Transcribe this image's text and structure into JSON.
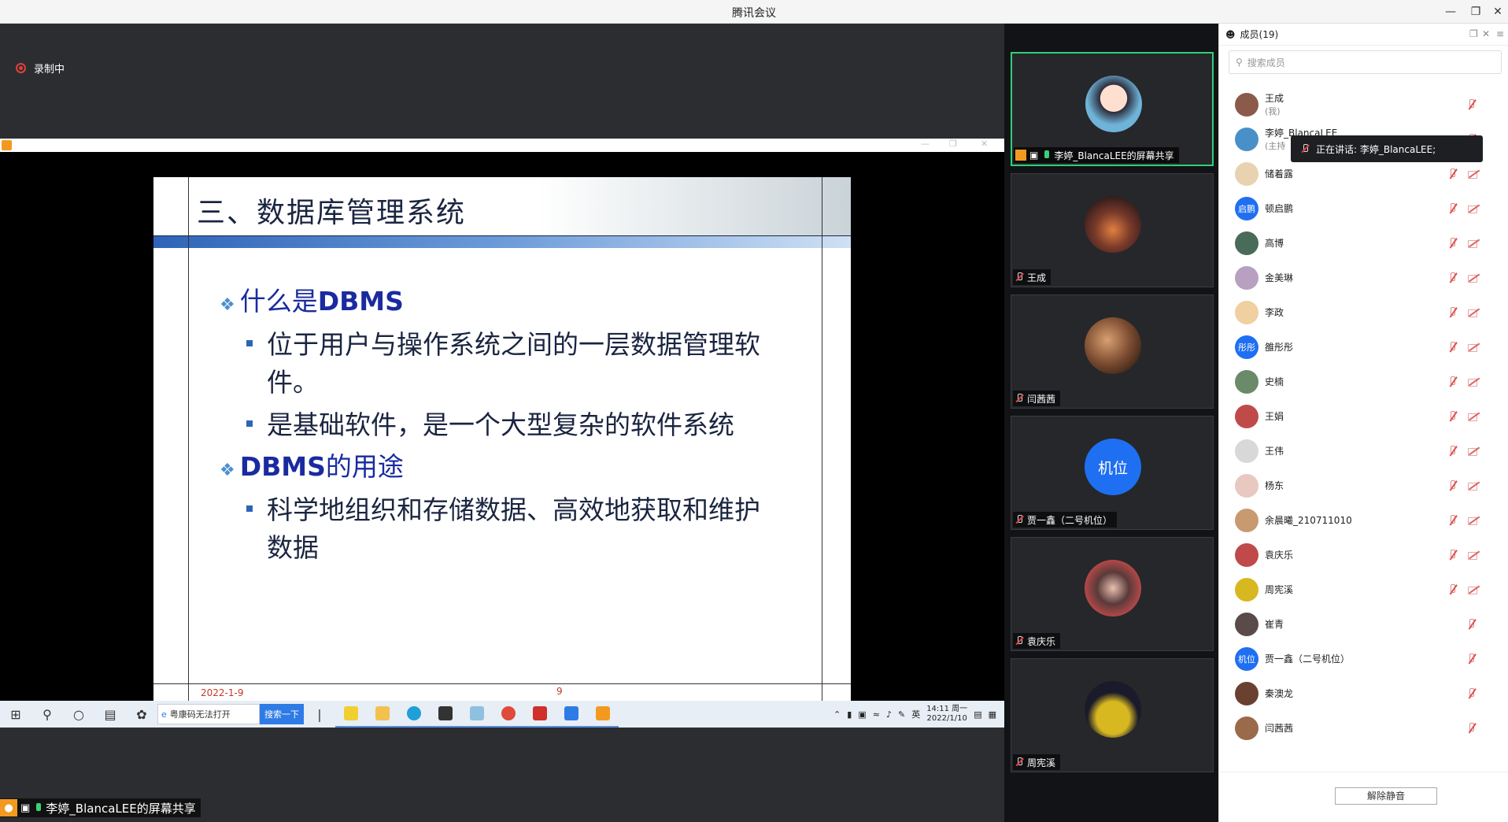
{
  "window": {
    "title": "腾讯会议"
  },
  "recording": {
    "label": "录制中"
  },
  "slide": {
    "title": "三、数据库管理系统",
    "bullet1_pre": "什么是",
    "bullet1_bold": "DBMS",
    "sub1_line1": "位于用户与操作系统之间的一层数据管理软",
    "sub1_line2": "件。",
    "sub2": "是基础软件，是一个大型复杂的软件系统",
    "bullet2_bold": "DBMS",
    "bullet2_post": "的用途",
    "sub3_line1": "科学地组织和存储数据、高效地获取和维护",
    "sub3_line2": "数据",
    "footer_date": "2022-1-9",
    "footer_page": "9"
  },
  "taskbar": {
    "search_text": "粤康码无法打开",
    "search_button": "搜索一下",
    "ime": "英",
    "time": "14:11 周一",
    "date": "2022/1/10"
  },
  "share_tag": {
    "label": "李婷_BlancaLEE的屏幕共享"
  },
  "tiles": [
    {
      "name": "李婷_BlancaLEE的屏幕共享",
      "color": "#6fb3d8"
    },
    {
      "name": "王成",
      "color": "#8a4a3a"
    },
    {
      "name": "闫茜茜",
      "color": "#9a6a4a"
    },
    {
      "name": "贾一鑫（二号机位）",
      "color": "#1f6ff2",
      "avatar_text": "机位"
    },
    {
      "name": "袁庆乐",
      "color": "#c04a4a"
    },
    {
      "name": "周宪溪",
      "color": "#d8b820"
    }
  ],
  "panel": {
    "title": "成员(19)",
    "search_placeholder": "搜索成员",
    "tooltip": "正在讲话: 李婷_BlancaLEE;",
    "unmute_button": "解除静音",
    "members": [
      {
        "name": "王成",
        "sub": "(我)",
        "color": "#8a5a4a",
        "cam": false
      },
      {
        "name": "李婷_BlancaLEE",
        "sub": "(主持",
        "color": "#4a90c8",
        "cam": false
      },
      {
        "name": "储着露",
        "sub": "",
        "color": "#e8d2b0",
        "cam": true
      },
      {
        "name": "顿启鹏",
        "sub": "",
        "color": "#1f6ff2",
        "avatar_text": "启鹏",
        "cam": true
      },
      {
        "name": "高博",
        "sub": "",
        "color": "#4a6a5a",
        "cam": true
      },
      {
        "name": "金美琳",
        "sub": "",
        "color": "#b8a0c0",
        "cam": true
      },
      {
        "name": "李政",
        "sub": "",
        "color": "#f0d0a0",
        "cam": true
      },
      {
        "name": "雒彤彤",
        "sub": "",
        "color": "#1f6ff2",
        "avatar_text": "彤彤",
        "cam": true
      },
      {
        "name": "史楠",
        "sub": "",
        "color": "#6a8a6a",
        "cam": true
      },
      {
        "name": "王娟",
        "sub": "",
        "color": "#c04a4a",
        "cam": true
      },
      {
        "name": "王伟",
        "sub": "",
        "color": "#d8d8d8",
        "cam": true
      },
      {
        "name": "杨东",
        "sub": "",
        "color": "#e8c8c0",
        "cam": true
      },
      {
        "name": "余晨曦_210711010",
        "sub": "",
        "color": "#c89a70",
        "cam": true
      },
      {
        "name": "袁庆乐",
        "sub": "",
        "color": "#c04a4a",
        "cam": true
      },
      {
        "name": "周宪溪",
        "sub": "",
        "color": "#d8b820",
        "cam": true
      },
      {
        "name": "崔青",
        "sub": "",
        "color": "#5a4a4a",
        "cam": false
      },
      {
        "name": "贾一鑫（二号机位）",
        "sub": "",
        "color": "#1f6ff2",
        "avatar_text": "机位",
        "cam": false
      },
      {
        "name": "秦澳龙",
        "sub": "",
        "color": "#6a4030",
        "cam": false
      },
      {
        "name": "闫茜茜",
        "sub": "",
        "color": "#9a6a4a",
        "cam": false
      }
    ]
  }
}
